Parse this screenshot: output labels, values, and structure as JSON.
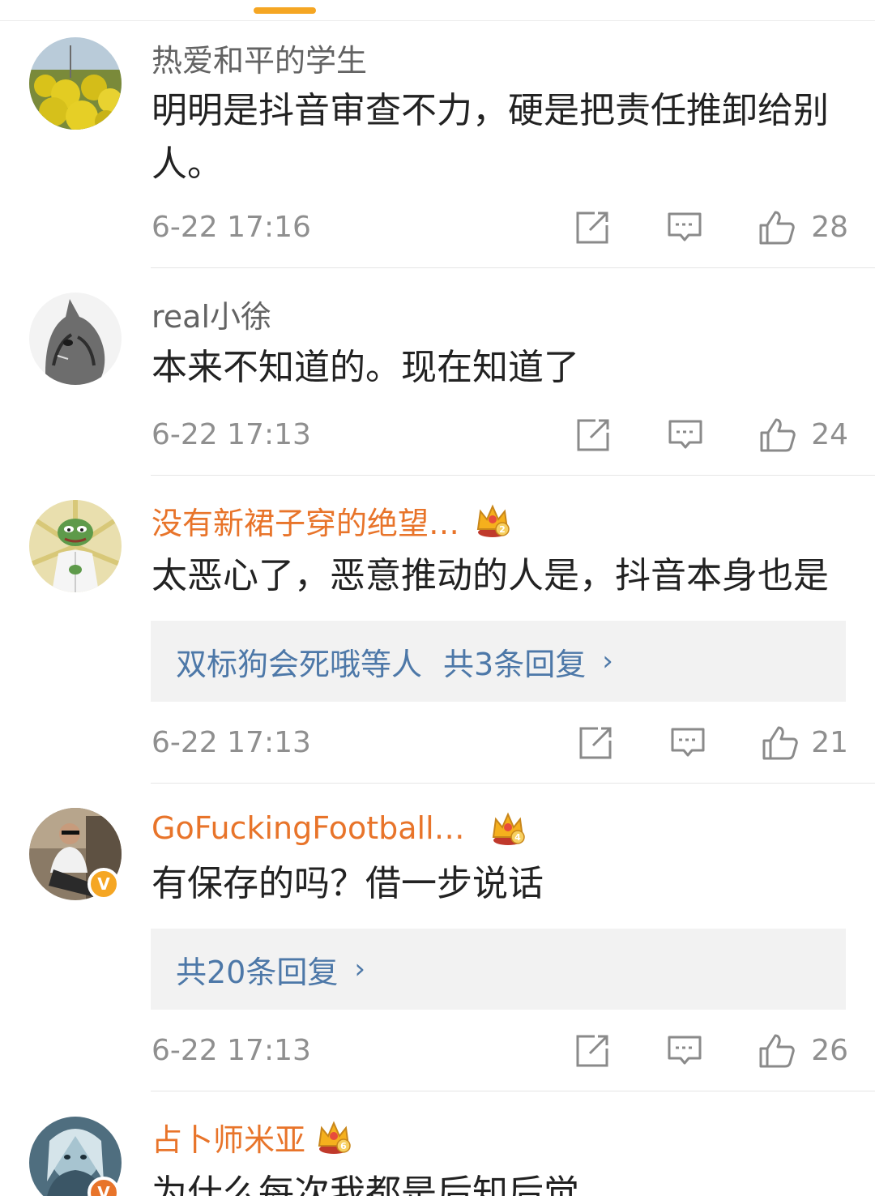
{
  "comments": [
    {
      "username": "热爱和平的学生",
      "text": "明明是抖音审查不力，硬是把责任推卸给别人。",
      "time": "6-22 17:16",
      "likes": "28",
      "vip": false
    },
    {
      "username": "real小徐",
      "text": "本来不知道的。现在知道了",
      "time": "6-22 17:13",
      "likes": "24",
      "vip": false
    },
    {
      "username": "没有新裙子穿的绝望…",
      "text": "太恶心了，恶意推动的人是，抖音本身也是",
      "time": "6-22 17:13",
      "likes": "21",
      "vip": true,
      "crown_level": "2",
      "reply_who": "双标狗会死哦等人",
      "reply_count": "共3条回复"
    },
    {
      "username": "GoFuckingFootball…",
      "text": "有保存的吗？借一步说话",
      "time": "6-22 17:13",
      "likes": "26",
      "vip": true,
      "verified": true,
      "verified_mark": "V",
      "crown_level": "4",
      "reply_count": "共20条回复"
    },
    {
      "username": "占卜师米亚",
      "text": "为什么每次我都是后知后觉",
      "vip": true,
      "verified": true,
      "verified_mark": "V",
      "crown_level": "6"
    }
  ],
  "icons": {
    "share": "share-icon",
    "comment": "comment-icon",
    "like": "thumbs-up-icon",
    "chevron": "chevron-right-icon",
    "crown": "vip-crown-icon"
  },
  "colors": {
    "accent": "#f5a623",
    "vip_name": "#e8742a",
    "link": "#4d78a8"
  },
  "chevron_glyph": "›"
}
